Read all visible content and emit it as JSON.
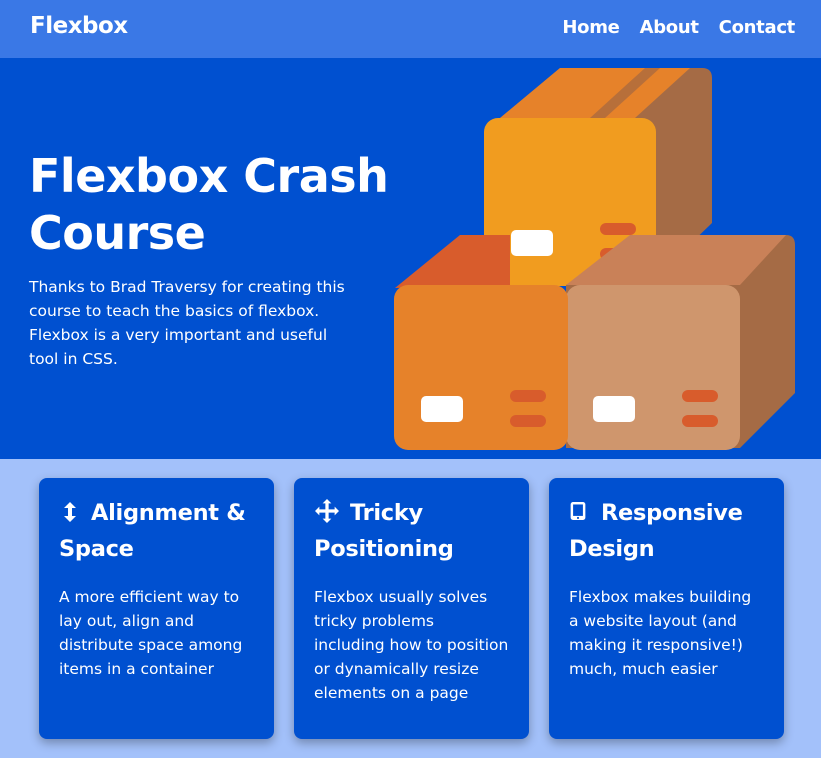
{
  "navbar": {
    "brand": "Flexbox",
    "links": [
      "Home",
      "About",
      "Contact"
    ]
  },
  "hero": {
    "title": "Flexbox Crash Course",
    "text": "Thanks to Brad Traversy for creating this course to teach the basics of flexbox. Flexbox is a very important and useful tool in CSS.",
    "illustration": "stacked-boxes-illustration"
  },
  "features": [
    {
      "icon": "vertical-arrows-icon",
      "title": "Alignment & Space",
      "text": "A more efficient way to lay out, align and distribute space among items in a container"
    },
    {
      "icon": "move-arrows-icon",
      "title": "Tricky Positioning",
      "text": "Flexbox usually solves tricky problems including how to position or dynamically resize elements on a page"
    },
    {
      "icon": "mobile-phone-icon",
      "title": "Responsive Design",
      "text": "Flexbox makes building a website layout (and making it responsive!) much, much easier"
    }
  ],
  "colors": {
    "navbar_bg": "#3a78e6",
    "hero_bg": "#0050d0",
    "page_bg": "#a3c1fa",
    "card_bg": "#0050d0"
  }
}
